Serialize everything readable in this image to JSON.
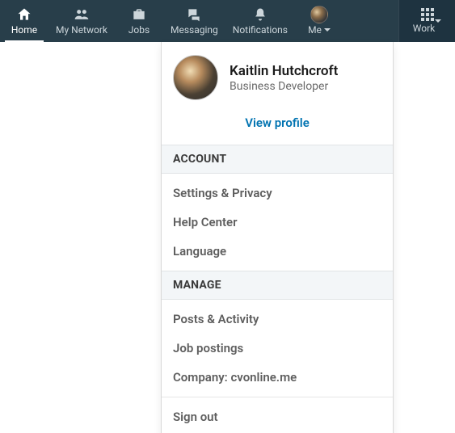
{
  "nav": {
    "home": "Home",
    "network": "My Network",
    "jobs": "Jobs",
    "messaging": "Messaging",
    "notifications": "Notifications",
    "me": "Me",
    "work": "Work"
  },
  "profile": {
    "name": "Kaitlin Hutchcroft",
    "role": "Business Developer",
    "view_profile": "View profile"
  },
  "sections": {
    "account_header": "ACCOUNT",
    "manage_header": "MANAGE"
  },
  "account_items": {
    "settings": "Settings & Privacy",
    "help": "Help Center",
    "language": "Language"
  },
  "manage_items": {
    "posts": "Posts & Activity",
    "jobs": "Job postings",
    "company": "Company: cvonline.me"
  },
  "signout": "Sign out"
}
